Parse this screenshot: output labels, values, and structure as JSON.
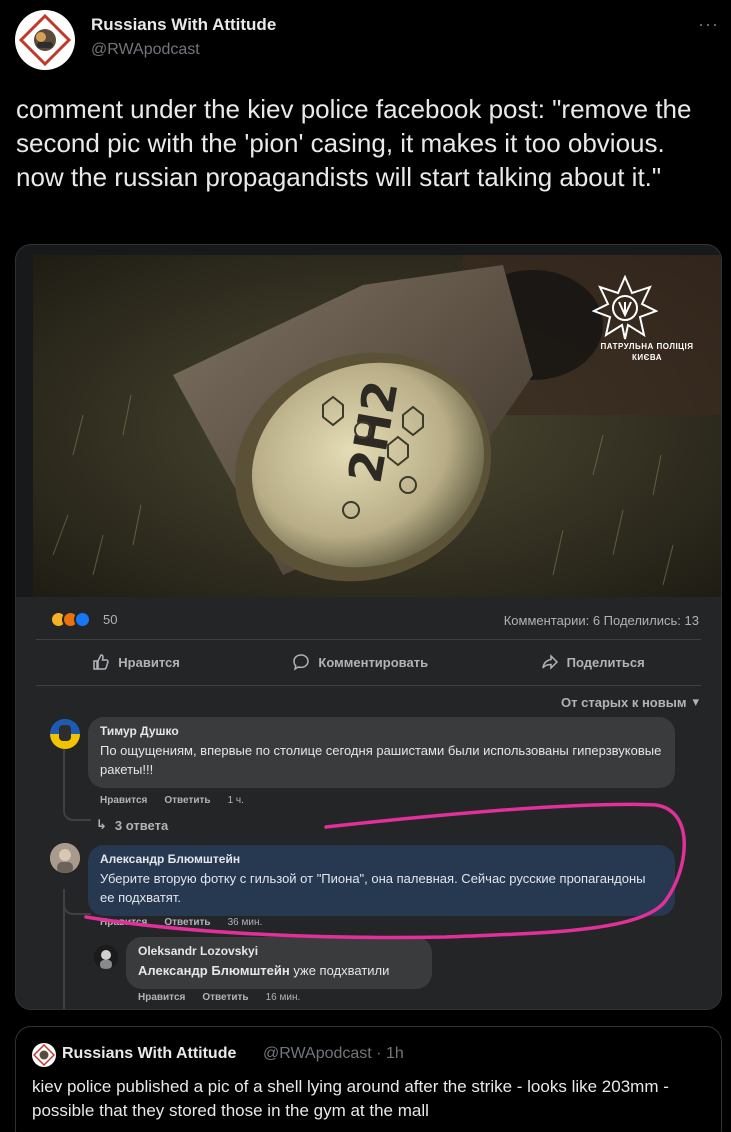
{
  "tweet": {
    "author_name": "Russians With Attitude",
    "author_handle": "@RWApodcast",
    "more_label": "···",
    "text": "comment under the kiev police facebook post: \"remove the second pic with the 'pion' casing, it makes it too obvious. now the russian propagandists will start talking about it.\""
  },
  "screenshot": {
    "photo": {
      "shell_marking": "2Н2",
      "watermark_line1": "ПАТРУЛЬНА ПОЛІЦІЯ",
      "watermark_line2": "КИЄВА"
    },
    "reactions": {
      "count": "50",
      "stats": "Комментарии: 6  Поделились: 13"
    },
    "actions": {
      "like": "Нравится",
      "comment": "Комментировать",
      "share": "Поделиться"
    },
    "sort_label": "От старых к новым",
    "comments": [
      {
        "name": "Тимур Душко",
        "text": "По ощущениям, впервые по столице сегодня рашистами были использованы гиперзвуковые ракеты!!!",
        "like": "Нравится",
        "reply": "Ответить",
        "time": "1 ч.",
        "replies_label": "3 ответа"
      },
      {
        "name": "Александр Блюмштейн",
        "text": "Уберите вторую фотку с гильзой от \"Пиона\", она палевная. Сейчас русские пропагандоны ее подхватят.",
        "like": "Нравится",
        "reply": "Ответить",
        "time": "36 мин."
      },
      {
        "name": "Oleksandr Lozovskyi",
        "mention": "Александр Блюмштейн",
        "text": " уже подхватили",
        "like": "Нравится",
        "reply": "Ответить",
        "time": "16 мин."
      }
    ]
  },
  "quote": {
    "author_name": "Russians With Attitude",
    "author_handle": "@RWApodcast · 1h",
    "text": "kiev police published a pic of a shell lying around after the strike - looks like 203mm - possible that they stored those in the gym at the mall"
  },
  "colors": {
    "background": "#000000",
    "facebook_panel": "#242526",
    "highlight_bubble": "#263951",
    "annotation": "#e0309a"
  }
}
